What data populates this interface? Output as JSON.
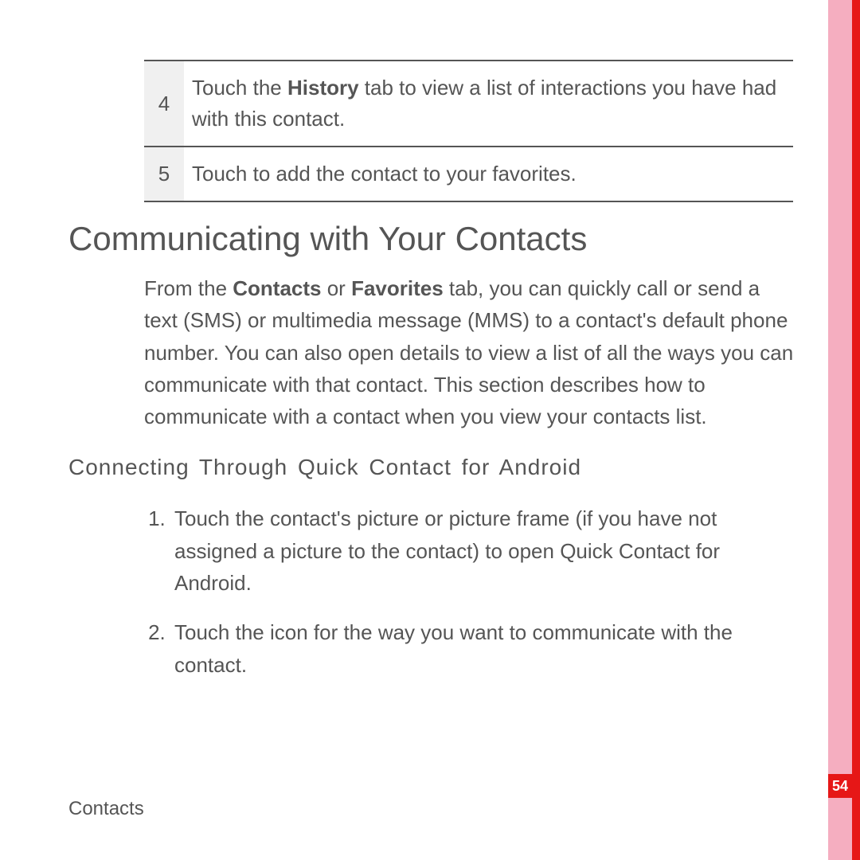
{
  "table": {
    "row4": {
      "num": "4",
      "pre": "Touch the ",
      "bold": "History",
      "post": " tab to view a list of interactions you have had with this contact."
    },
    "row5": {
      "num": "5",
      "text": "Touch to add the contact to your favorites."
    }
  },
  "heading": "Communicating with Your Contacts",
  "para": {
    "pre": "From the ",
    "b1": "Contacts",
    "mid": " or ",
    "b2": "Favorites",
    "post": " tab, you can quickly call or send a text (SMS) or multimedia message (MMS) to a contact's default phone number. You can also open details to view a list of all the ways you can communicate with that contact. This section describes how to communicate with a contact when you view your contacts list."
  },
  "subheading": "Connecting Through Quick Contact for Android",
  "list": {
    "item1": "Touch the contact's picture or picture frame (if you have not assigned a picture to the contact) to open Quick Contact for Android.",
    "item2": "Touch the icon for the way you want to communicate with the contact."
  },
  "footer": "Contacts",
  "pagenum": "54"
}
